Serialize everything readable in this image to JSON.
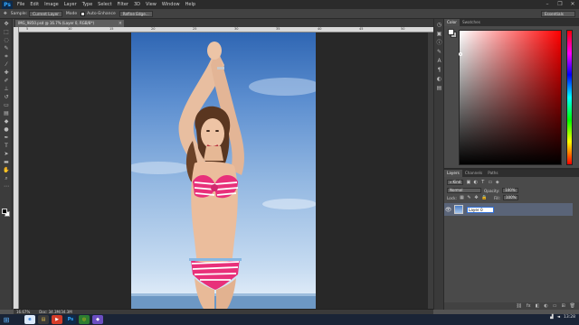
{
  "app": {
    "logo": "Ps"
  },
  "menu": [
    "File",
    "Edit",
    "Image",
    "Layer",
    "Type",
    "Select",
    "Filter",
    "3D",
    "View",
    "Window",
    "Help"
  ],
  "window_controls": [
    "minimize-icon",
    "restore-icon",
    "close-icon"
  ],
  "options_bar": {
    "label1": "Sample:",
    "sample_value": "Current Layer",
    "label2": "Mode",
    "chk_label": "Auto-Enhance",
    "refine_edge": "Refine Edge...",
    "workspace": "Essentials"
  },
  "document": {
    "tab_title": "IMG_9850.psd @ 16.7% (Layer 0, RGB/8*)",
    "tab_close": "×",
    "ruler_ticks": [
      "5",
      "10",
      "15",
      "20",
      "25",
      "30",
      "35",
      "40",
      "45",
      "50"
    ],
    "zoom": "16.67%",
    "doc_size": "Doc: 34.3M/34.3M"
  },
  "color_panel": {
    "tabs": [
      "Color",
      "Swatches"
    ],
    "foreground_color": "#ffffff",
    "background_color": "#b8b8b8"
  },
  "layers_panel": {
    "tabs": [
      "Layers",
      "Channels",
      "Paths"
    ],
    "kind_label": "Kind",
    "blend_mode": "Normal",
    "opacity_label": "Opacity:",
    "opacity_value": "100%",
    "lock_label": "Lock:",
    "fill_label": "Fill:",
    "fill_value": "100%",
    "layer_name": "Layer 0"
  },
  "taskbar": {
    "apps": [
      {
        "label": "e",
        "color": "#2b7bd6",
        "bg": "#dbe9fb"
      },
      {
        "label": "▤",
        "color": "#e8c14a",
        "bg": "#3a3a3a"
      },
      {
        "label": "▶",
        "color": "#ffffff",
        "bg": "#d43d2a"
      },
      {
        "label": "Ps",
        "color": "#31a8ff",
        "bg": "#0e2a4a"
      },
      {
        "label": "◎",
        "color": "#f4c20d",
        "bg": "#2d7d32"
      },
      {
        "label": "◆",
        "color": "#ffffff",
        "bg": "#6b4ec1"
      }
    ],
    "time": "13:28"
  }
}
